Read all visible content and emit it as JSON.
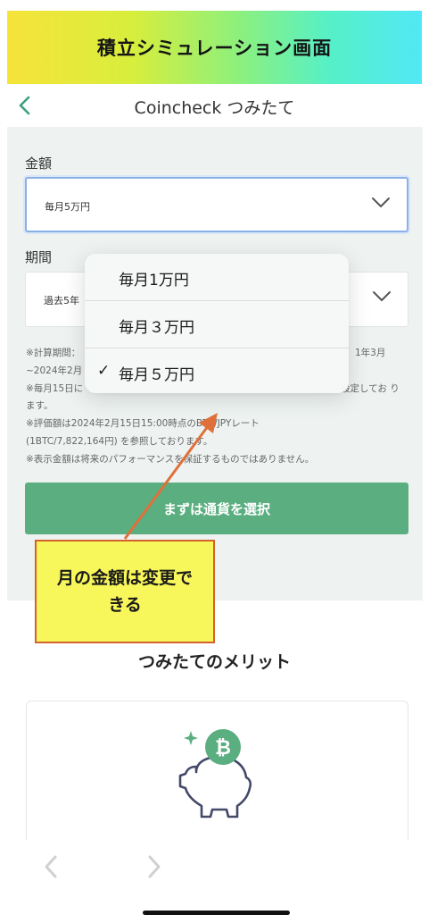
{
  "banner": {
    "title": "積立シミュレーション画面"
  },
  "nav": {
    "title": "Coincheck つみたて",
    "back_icon": "chevron-left-icon"
  },
  "form": {
    "amount_label": "金額",
    "amount_value": "毎月5万円",
    "period_label": "期間",
    "period_value": "過去5年"
  },
  "notes": [
    "※計算期間：",
    "~2024年2月",
    "※毎月15日に",
    "ます。",
    "※評価額は2024年2月15日15:00時点のBTC/JPYレート",
    "(1BTC/7,822,164円) を参照しております。",
    "※表示金額は将来のパフォーマンスを保証するものではありません。"
  ],
  "notes_fragments": {
    "right_1": "1年3月",
    "right_3": "設定してお り"
  },
  "cta_label": "まずは通貨を選択",
  "dropdown": {
    "options": [
      "毎月1万円",
      "毎月３万円",
      "毎月５万円"
    ],
    "selected_index": 2,
    "check_glyph": "✓"
  },
  "callout": {
    "text": "月の金額は変更できる"
  },
  "merit": {
    "title": "つみたてのメリット"
  },
  "colors": {
    "accent_green": "#5aae80",
    "back_green": "#3aa079",
    "coin_green": "#5aae80",
    "callout_fill": "#f7f65a",
    "callout_border": "#d4622c",
    "focus_blue": "#8ab0e6"
  }
}
